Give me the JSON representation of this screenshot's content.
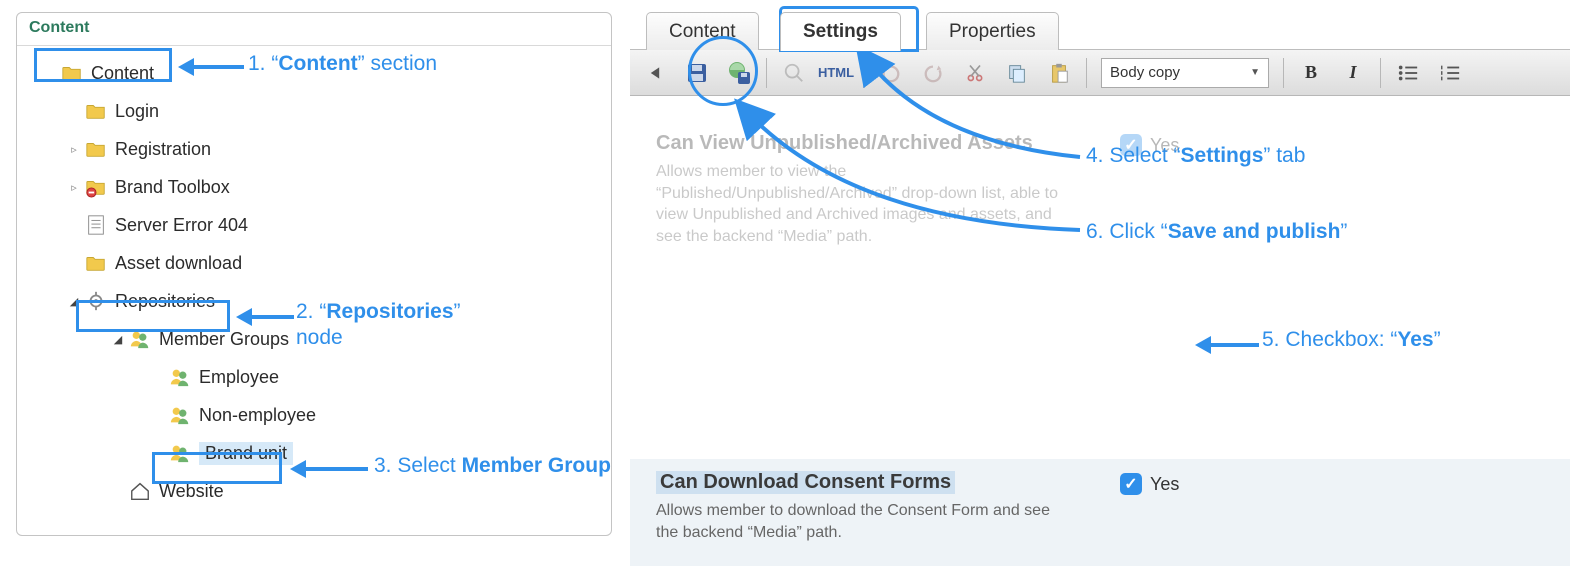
{
  "leftPanel": {
    "title": "Content",
    "tree": {
      "root": {
        "label": "Content"
      },
      "items": [
        {
          "label": "Login"
        },
        {
          "label": "Registration"
        },
        {
          "label": "Brand Toolbox"
        },
        {
          "label": "Server Error 404"
        },
        {
          "label": "Asset download"
        },
        {
          "label": "Repositories"
        },
        {
          "label": "Member Groups"
        },
        {
          "label": "Employee"
        },
        {
          "label": "Non-employee"
        },
        {
          "label": "Brand unit"
        },
        {
          "label": "Website"
        }
      ]
    }
  },
  "rightPanel": {
    "tabs": {
      "content": "Content",
      "settings": "Settings",
      "properties": "Properties",
      "active": "settings"
    },
    "toolbar": {
      "htmlLabel": "HTML",
      "formatSelect": "Body copy",
      "bold": "B",
      "italic": "I"
    },
    "fieldFaded": {
      "title": "Can View Unpublished/Archived Assets",
      "desc": "Allows member to view the “Published/Unpublished/Archived” drop-down list, able to view Unpublished and Archived images and assets, and see the backend “Media” path.",
      "yes": "Yes"
    },
    "fieldActive": {
      "title": "Can Download Consent Forms",
      "desc": "Allows member to download the Consent Form and see the backend “Media” path.",
      "yes": "Yes"
    }
  },
  "annotations": {
    "a1_pre": "1. “",
    "a1_b": "Content",
    "a1_post": "” section",
    "a2_pre": "2. “",
    "a2_b": "Repositories",
    "a2_post": "”",
    "a2_line2": "node",
    "a3_pre": "3. Select ",
    "a3_b": "Member Group",
    "a4_pre": "4. Select “",
    "a4_b": "Settings",
    "a4_post": "” tab",
    "a5_pre": "5. Checkbox: “",
    "a5_b": "Yes",
    "a5_post": "”",
    "a6_pre": "6. Click “",
    "a6_b": "Save and publish",
    "a6_post": "”"
  },
  "colors": {
    "accent": "#2f8fea"
  }
}
